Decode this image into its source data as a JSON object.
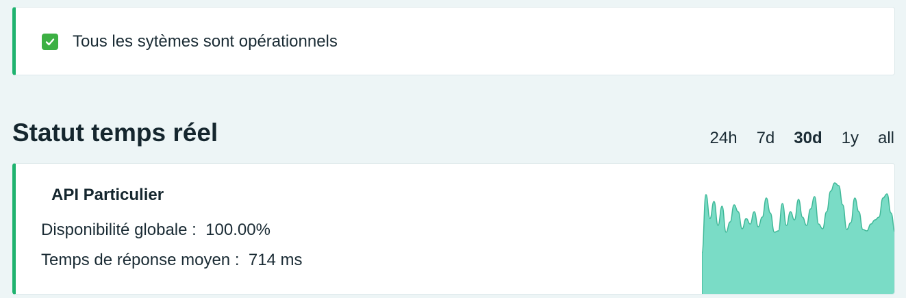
{
  "status_banner": {
    "icon": "check-mark-icon",
    "text": "Tous les sytèmes sont opérationnels",
    "accent_color": "#1fb36f"
  },
  "realtime": {
    "title": "Statut temps réel",
    "ranges": [
      {
        "label": "24h",
        "active": false
      },
      {
        "label": "7d",
        "active": false
      },
      {
        "label": "30d",
        "active": true
      },
      {
        "label": "1y",
        "active": false
      },
      {
        "label": "all",
        "active": false
      }
    ]
  },
  "api_card": {
    "name": "API Particulier",
    "availability_label": "Disponibilité globale :",
    "availability_value": "100.00%",
    "response_label": "Temps de réponse moyen :",
    "response_value": "714 ms",
    "sparkline_color": "#7adcc6",
    "sparkline_stroke": "#3fb898"
  }
}
